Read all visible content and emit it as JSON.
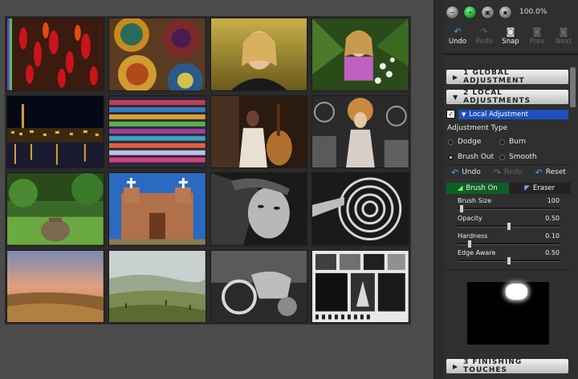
{
  "toolbar": {
    "zoom_label": "100.0%",
    "undo_label": "Undo",
    "redo_label": "Redo",
    "snap_label": "Snap",
    "prev_label": "Prev",
    "next_label": "Next"
  },
  "sections": {
    "global": "1 GLOBAL ADJUSTMENT",
    "local": "2 LOCAL ADJUSTMENTS",
    "finishing": "3 FINISHING TOUCHES"
  },
  "local": {
    "selected_item": "Local Adjustment",
    "adjustment_type_label": "Adjustment Type",
    "types": [
      {
        "label": "Dodge",
        "selected": false
      },
      {
        "label": "Burn",
        "selected": false
      },
      {
        "label": "Brush Out",
        "selected": true
      },
      {
        "label": "Smooth",
        "selected": false
      }
    ],
    "undo_label": "Undo",
    "redo_label": "Redo",
    "reset_label": "Reset",
    "brush_tab": "Brush On",
    "eraser_tab": "Eraser",
    "sliders": [
      {
        "label": "Brush Size",
        "value": "100",
        "fraction": 0.02
      },
      {
        "label": "Opacity",
        "value": "0.50",
        "fraction": 0.5
      },
      {
        "label": "Hardness",
        "value": "0.10",
        "fraction": 0.1
      },
      {
        "label": "Edge Aware",
        "value": "0.50",
        "fraction": 0.5
      }
    ]
  },
  "thumbnails": [
    {
      "name": "chili-peppers"
    },
    {
      "name": "pottery-plates"
    },
    {
      "name": "woman-portrait"
    },
    {
      "name": "girl-flowers"
    },
    {
      "name": "city-night"
    },
    {
      "name": "colored-threads"
    },
    {
      "name": "musician-bass"
    },
    {
      "name": "fashion-curls"
    },
    {
      "name": "garden-urn"
    },
    {
      "name": "adobe-church"
    },
    {
      "name": "bw-face"
    },
    {
      "name": "spiral-stairs"
    },
    {
      "name": "sunset-field"
    },
    {
      "name": "tuscany-hills"
    },
    {
      "name": "bw-motorcycle"
    },
    {
      "name": "bw-collage"
    }
  ]
}
